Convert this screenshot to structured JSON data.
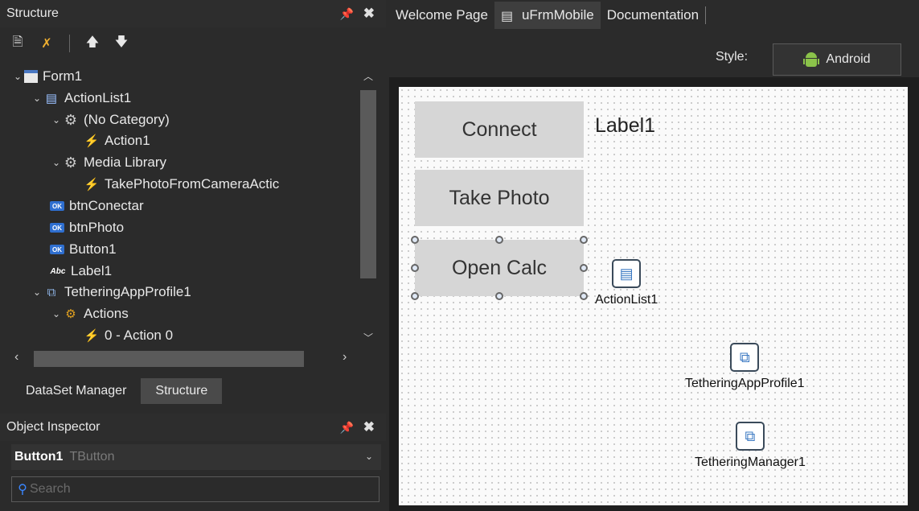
{
  "structure_panel": {
    "title": "Structure",
    "toolbar": [
      "new-item-icon",
      "delete-item-icon",
      "move-up-icon",
      "move-down-icon"
    ],
    "tree": [
      {
        "label": "Form1",
        "level": 0,
        "expanded": true,
        "icon": "form-icon"
      },
      {
        "label": "ActionList1",
        "level": 1,
        "expanded": true,
        "icon": "actionlist-icon"
      },
      {
        "label": "(No Category)",
        "level": 2,
        "expanded": true,
        "icon": "category-icon"
      },
      {
        "label": "Action1",
        "level": 3,
        "icon": "action-icon"
      },
      {
        "label": "Media Library",
        "level": 2,
        "expanded": true,
        "icon": "category-icon"
      },
      {
        "label": "TakePhotoFromCameraActic",
        "level": 3,
        "icon": "action-icon"
      },
      {
        "label": "btnConectar",
        "level": 1,
        "icon": "button-icon"
      },
      {
        "label": "btnPhoto",
        "level": 1,
        "icon": "button-icon"
      },
      {
        "label": "Button1",
        "level": 1,
        "icon": "button-icon"
      },
      {
        "label": "Label1",
        "level": 1,
        "icon": "label-icon"
      },
      {
        "label": "TetheringAppProfile1",
        "level": 1,
        "expanded": true,
        "icon": "tethering-icon"
      },
      {
        "label": "Actions",
        "level": 2,
        "expanded": true,
        "icon": "actions-icon"
      },
      {
        "label": "0 - Action 0",
        "level": 3,
        "icon": "action-icon"
      }
    ]
  },
  "bottom_tabs": [
    {
      "label": "DataSet Manager",
      "active": false
    },
    {
      "label": "Structure",
      "active": true
    }
  ],
  "object_inspector": {
    "title": "Object Inspector",
    "selected_name": "Button1",
    "selected_class": "TButton",
    "search_placeholder": "Search"
  },
  "document_tabs": [
    {
      "label": "Welcome Page",
      "active": false
    },
    {
      "label": "uFrmMobile",
      "active": true
    },
    {
      "label": "Documentation",
      "active": false
    }
  ],
  "style": {
    "label": "Style:",
    "value": "Android"
  },
  "form": {
    "buttons": [
      {
        "label": "Connect"
      },
      {
        "label": "Take Photo"
      },
      {
        "label": "Open Calc",
        "selected": true
      }
    ],
    "label1": "Label1",
    "components": [
      {
        "label": "ActionList1",
        "icon": "actionlist-icon"
      },
      {
        "label": "TetheringAppProfile1",
        "icon": "tethering-profile-icon"
      },
      {
        "label": "TetheringManager1",
        "icon": "tethering-manager-icon"
      }
    ]
  }
}
